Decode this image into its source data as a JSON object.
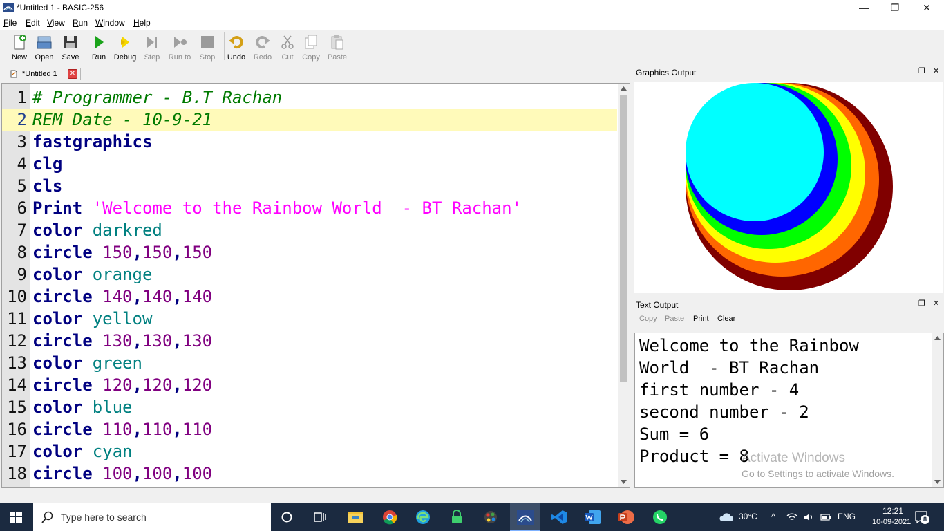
{
  "window": {
    "title": "*Untitled 1 - BASIC-256",
    "minimize": "—",
    "maximize": "❐",
    "close": "✕"
  },
  "menu": {
    "items": [
      {
        "label": "File",
        "key": "F",
        "rest": "ile"
      },
      {
        "label": "Edit",
        "key": "E",
        "rest": "dit"
      },
      {
        "label": "View",
        "key": "V",
        "rest": "iew"
      },
      {
        "label": "Run",
        "key": "R",
        "rest": "un"
      },
      {
        "label": "Window",
        "key": "W",
        "rest": "indow"
      },
      {
        "label": "Help",
        "key": "H",
        "rest": "elp"
      }
    ]
  },
  "toolbar": {
    "new": "New",
    "open": "Open",
    "save": "Save",
    "run": "Run",
    "debug": "Debug",
    "step": "Step",
    "run_to": "Run to",
    "stop": "Stop",
    "undo": "Undo",
    "redo": "Redo",
    "cut": "Cut",
    "copy": "Copy",
    "paste": "Paste"
  },
  "tab": {
    "label": "*Untitled 1",
    "close": "✕"
  },
  "editor": {
    "lines": [
      {
        "n": "1",
        "parts": [
          {
            "t": "# Programmer - B.T Rachan",
            "c": "cm"
          }
        ]
      },
      {
        "n": "2",
        "parts": [
          {
            "t": "REM Date - 10-9-21",
            "c": "cm"
          }
        ],
        "current": true
      },
      {
        "n": "3",
        "parts": [
          {
            "t": "fastgraphics",
            "c": "kw"
          }
        ]
      },
      {
        "n": "4",
        "parts": [
          {
            "t": "clg",
            "c": "kw"
          }
        ]
      },
      {
        "n": "5",
        "parts": [
          {
            "t": "cls",
            "c": "kw"
          }
        ]
      },
      {
        "n": "6",
        "parts": [
          {
            "t": "Print ",
            "c": "kw"
          },
          {
            "t": "'Welcome to the Rainbow World  - BT Rachan'",
            "c": "str"
          }
        ]
      },
      {
        "n": "7",
        "parts": [
          {
            "t": "color ",
            "c": "kw"
          },
          {
            "t": "darkred",
            "c": "clr"
          }
        ]
      },
      {
        "n": "8",
        "parts": [
          {
            "t": "circle ",
            "c": "kw"
          },
          {
            "t": "150",
            "c": "num"
          },
          {
            "t": ",",
            "c": "punc"
          },
          {
            "t": "150",
            "c": "num"
          },
          {
            "t": ",",
            "c": "punc"
          },
          {
            "t": "150",
            "c": "num"
          }
        ]
      },
      {
        "n": "9",
        "parts": [
          {
            "t": "color ",
            "c": "kw"
          },
          {
            "t": "orange",
            "c": "clr"
          }
        ]
      },
      {
        "n": "10",
        "parts": [
          {
            "t": "circle ",
            "c": "kw"
          },
          {
            "t": "140",
            "c": "num"
          },
          {
            "t": ",",
            "c": "punc"
          },
          {
            "t": "140",
            "c": "num"
          },
          {
            "t": ",",
            "c": "punc"
          },
          {
            "t": "140",
            "c": "num"
          }
        ]
      },
      {
        "n": "11",
        "parts": [
          {
            "t": "color ",
            "c": "kw"
          },
          {
            "t": "yellow",
            "c": "clr"
          }
        ]
      },
      {
        "n": "12",
        "parts": [
          {
            "t": "circle ",
            "c": "kw"
          },
          {
            "t": "130",
            "c": "num"
          },
          {
            "t": ",",
            "c": "punc"
          },
          {
            "t": "130",
            "c": "num"
          },
          {
            "t": ",",
            "c": "punc"
          },
          {
            "t": "130",
            "c": "num"
          }
        ]
      },
      {
        "n": "13",
        "parts": [
          {
            "t": "color ",
            "c": "kw"
          },
          {
            "t": "green",
            "c": "clr"
          }
        ]
      },
      {
        "n": "14",
        "parts": [
          {
            "t": "circle ",
            "c": "kw"
          },
          {
            "t": "120",
            "c": "num"
          },
          {
            "t": ",",
            "c": "punc"
          },
          {
            "t": "120",
            "c": "num"
          },
          {
            "t": ",",
            "c": "punc"
          },
          {
            "t": "120",
            "c": "num"
          }
        ]
      },
      {
        "n": "15",
        "parts": [
          {
            "t": "color ",
            "c": "kw"
          },
          {
            "t": "blue",
            "c": "clr"
          }
        ]
      },
      {
        "n": "16",
        "parts": [
          {
            "t": "circle ",
            "c": "kw"
          },
          {
            "t": "110",
            "c": "num"
          },
          {
            "t": ",",
            "c": "punc"
          },
          {
            "t": "110",
            "c": "num"
          },
          {
            "t": ",",
            "c": "punc"
          },
          {
            "t": "110",
            "c": "num"
          }
        ]
      },
      {
        "n": "17",
        "parts": [
          {
            "t": "color ",
            "c": "kw"
          },
          {
            "t": "cyan",
            "c": "clr"
          }
        ]
      },
      {
        "n": "18",
        "parts": [
          {
            "t": "circle ",
            "c": "kw"
          },
          {
            "t": "100",
            "c": "num"
          },
          {
            "t": ",",
            "c": "punc"
          },
          {
            "t": "100",
            "c": "num"
          },
          {
            "t": ",",
            "c": "punc"
          },
          {
            "t": "100",
            "c": "num"
          }
        ]
      }
    ]
  },
  "graphics": {
    "title": "Graphics Output",
    "circles": [
      {
        "color": "#800000",
        "value": 150
      },
      {
        "color": "#ff6600",
        "value": 140
      },
      {
        "color": "#ffff00",
        "value": 130
      },
      {
        "color": "#00ff00",
        "value": 120
      },
      {
        "color": "#0000ff",
        "value": 110
      },
      {
        "color": "#00ffff",
        "value": 100
      }
    ]
  },
  "text_output": {
    "title": "Text Output",
    "buttons": {
      "copy": "Copy",
      "paste": "Paste",
      "print": "Print",
      "clear": "Clear"
    },
    "lines": [
      "Welcome to the Rainbow",
      "World  - BT Rachan",
      "first number - 4",
      "second number - 2",
      "Sum = 6",
      "Product = 8"
    ]
  },
  "watermark": {
    "line1": "Activate Windows",
    "line2": "Go to Settings to activate Windows."
  },
  "taskbar": {
    "search_placeholder": "Type here to search",
    "weather": "30°C",
    "lang": "ENG",
    "time": "12:21",
    "date": "10-09-2021",
    "notifications": "8"
  }
}
